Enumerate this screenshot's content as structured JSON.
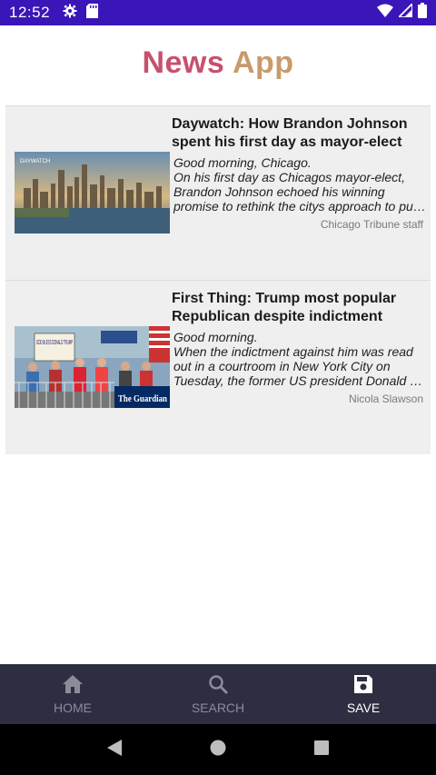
{
  "status_bar": {
    "time": "12:52",
    "icons_left": [
      "gear-icon",
      "sd-card-icon"
    ],
    "icons_right": [
      "wifi-icon",
      "signal-icon",
      "battery-icon"
    ]
  },
  "app": {
    "title_parts": [
      "News",
      " ",
      "App"
    ]
  },
  "articles": [
    {
      "title": "Daywatch: How Brandon Johnson spent his first day as mayor-elect",
      "image_caption": "DAYWATCH",
      "greeting": "Good morning, Chicago.",
      "body_line1": "On his first day as Chicagos mayor-elect,",
      "body_line2": "Brandon Johnson echoed his winning",
      "body_line3": "promise to rethink the citys approach to pub…",
      "author": "Chicago Tribune staff"
    },
    {
      "title": "First Thing: Trump most popular Republican despite indictment",
      "image_sign": "GOD BLESS DONALD TRUMP",
      "image_logo": "The Guardian",
      "greeting": "Good morning.",
      "body_line1": "When the indictment against him was read",
      "body_line2": "out in a courtroom in New York City on",
      "body_line3": "Tuesday, the former US president Donald Tr…",
      "author": "Nicola Slawson"
    }
  ],
  "bottom_nav": {
    "items": [
      {
        "label": "HOME",
        "icon": "home-icon",
        "active": false
      },
      {
        "label": "SEARCH",
        "icon": "search-icon",
        "active": false
      },
      {
        "label": "SAVE",
        "icon": "save-icon",
        "active": true
      }
    ]
  },
  "colors": {
    "status_bar": "#3a16b8",
    "nav_bg": "#2e2e42",
    "card_bg": "#efefef",
    "title_news": "#c8506e",
    "title_app": "#c99a6a"
  }
}
